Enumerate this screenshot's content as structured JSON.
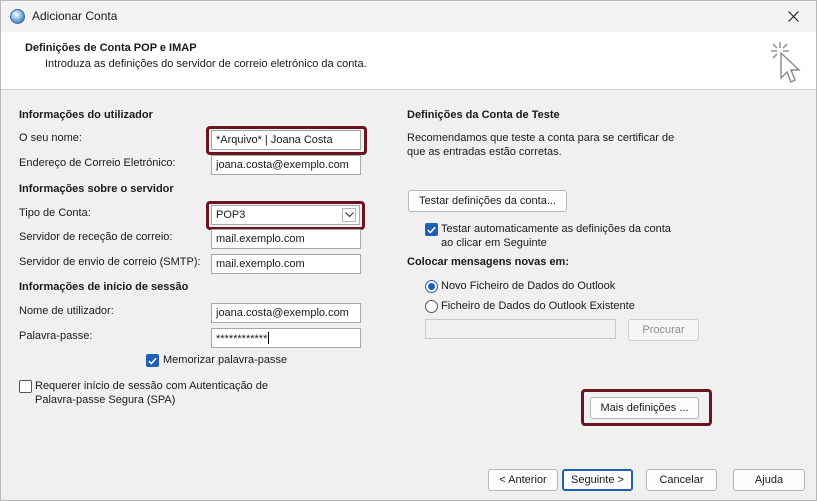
{
  "window": {
    "title": "Adicionar Conta",
    "close_icon": "close-icon"
  },
  "header": {
    "title": "Definições de Conta POP e IMAP",
    "subtitle": "Introduza as definições do servidor de correio eletrónico da conta."
  },
  "user_info": {
    "section_title": "Informações do utilizador",
    "name_label": "O seu nome:",
    "name_value": "*Arquivo* | Joana Costa",
    "email_label": "Endereço de Correio Eletrónico:",
    "email_value": "joana.costa@exemplo.com"
  },
  "server_info": {
    "section_title": "Informações sobre o servidor",
    "account_type_label": "Tipo de Conta:",
    "account_type_value": "POP3",
    "incoming_label": "Servidor de receção de correio:",
    "incoming_value": "mail.exemplo.com",
    "outgoing_label": "Servidor de envio de correio (SMTP):",
    "outgoing_value": "mail.exemplo.com"
  },
  "logon_info": {
    "section_title": "Informações de início de sessão",
    "username_label": "Nome de utilizador:",
    "username_value": "joana.costa@exemplo.com",
    "password_label": "Palavra-passe:",
    "password_value": "************",
    "remember_label": "Memorizar palavra-passe",
    "remember_checked": true,
    "spa_label_line1": "Requerer início de sessão com Autenticação de",
    "spa_label_line2": "Palavra-passe Segura (SPA)",
    "spa_checked": false
  },
  "test_settings": {
    "section_title": "Definições da Conta de Teste",
    "description_line1": "Recomendamos que teste a conta para se certificar de",
    "description_line2": "que as entradas estão corretas.",
    "test_button": "Testar definições da conta...",
    "auto_test_line1": "Testar automaticamente as definições da conta",
    "auto_test_line2": "ao clicar em Seguinte",
    "auto_test_checked": true
  },
  "deliver_to": {
    "section_title": "Colocar mensagens novas em:",
    "option_new": "Novo Ficheiro de Dados do Outlook",
    "option_existing": "Ficheiro de Dados do Outlook Existente",
    "selected": "new",
    "path_value": "",
    "browse_button": "Procurar"
  },
  "more_settings_button": "Mais definições ...",
  "footer": {
    "back_button": "< Anterior",
    "next_button": "Seguinte >",
    "cancel_button": "Cancelar",
    "help_button": "Ajuda"
  },
  "colors": {
    "accent": "#1f5fb8",
    "highlight": "#6b1320"
  }
}
